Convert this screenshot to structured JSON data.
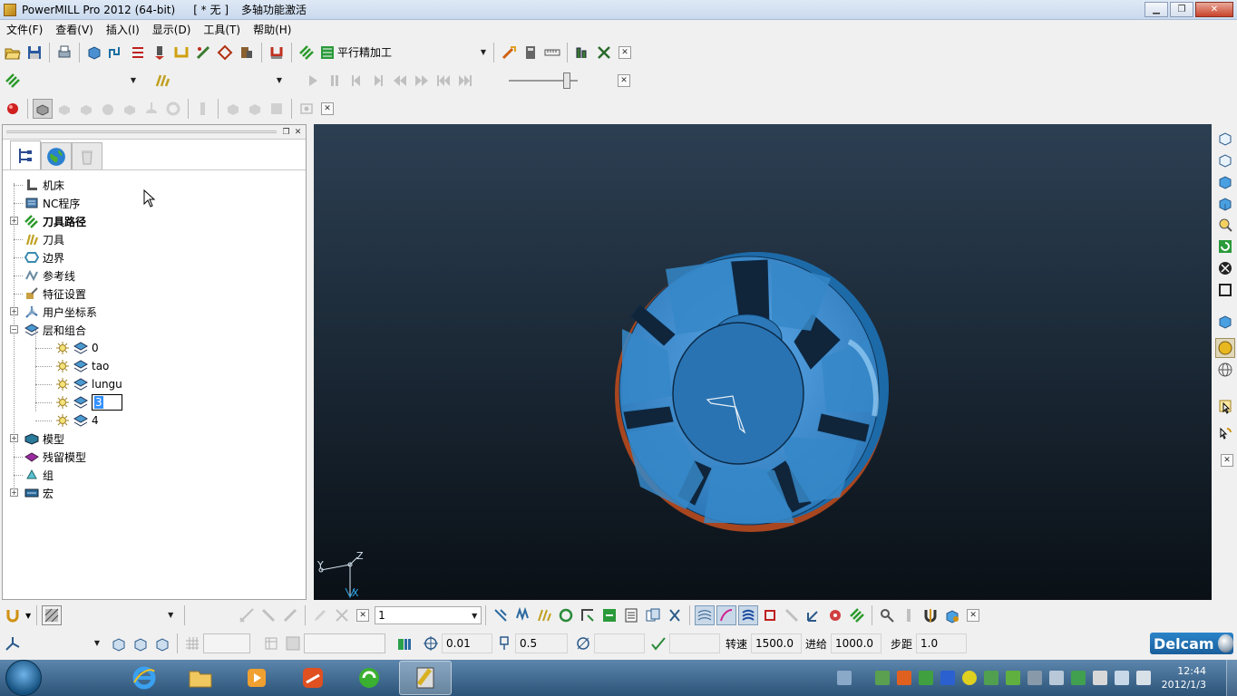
{
  "window": {
    "app_name": "PowerMILL Pro 2012 (64-bit)",
    "doc_name": "[ * 无 ]",
    "status": "多轴功能激活"
  },
  "menu": [
    "文件(F)",
    "查看(V)",
    "插入(I)",
    "显示(D)",
    "工具(T)",
    "帮助(H)"
  ],
  "toolbar1": {
    "toolpath_combo": "平行精加工"
  },
  "toolbar2": {
    "toolpath_select": "",
    "tool_select": ""
  },
  "explorer": {
    "tree": [
      {
        "label": "机床",
        "bold": false,
        "expandable": false,
        "icon": "machine-icon"
      },
      {
        "label": "NC程序",
        "bold": false,
        "expandable": false,
        "icon": "nc-program-icon"
      },
      {
        "label": "刀具路径",
        "bold": true,
        "expandable": true,
        "icon": "toolpath-icon"
      },
      {
        "label": "刀具",
        "bold": false,
        "expandable": false,
        "icon": "tool-icon"
      },
      {
        "label": "边界",
        "bold": false,
        "expandable": false,
        "icon": "boundary-icon"
      },
      {
        "label": "参考线",
        "bold": false,
        "expandable": false,
        "icon": "pattern-icon"
      },
      {
        "label": "特征设置",
        "bold": false,
        "expandable": false,
        "icon": "feature-icon"
      },
      {
        "label": "用户坐标系",
        "bold": false,
        "expandable": true,
        "icon": "workplane-icon"
      },
      {
        "label": "层和组合",
        "bold": false,
        "expandable": true,
        "expanded": true,
        "icon": "layer-icon"
      }
    ],
    "layers": [
      "0",
      "tao",
      "lungu",
      "3",
      "4"
    ],
    "editing_layer_index": 3,
    "tree_after": [
      {
        "label": "模型",
        "bold": false,
        "expandable": true,
        "icon": "model-icon"
      },
      {
        "label": "残留模型",
        "bold": false,
        "expandable": false,
        "icon": "stock-model-icon"
      },
      {
        "label": "组",
        "bold": false,
        "expandable": false,
        "icon": "group-icon"
      },
      {
        "label": "宏",
        "bold": false,
        "expandable": true,
        "icon": "macro-icon"
      }
    ]
  },
  "viewport": {
    "triad": {
      "x": "X",
      "y": "Y",
      "z": "Z"
    },
    "background_top": "#2c3f52",
    "background_bottom": "#0a1016",
    "model_color": "#2f7fc0"
  },
  "bottom_toolbar1": {
    "layer_select": "",
    "number_select": "1"
  },
  "status_bar": {
    "tolerance": "0.01",
    "thickness": "0.5",
    "spindle_label": "转速",
    "spindle_value": "1500.0",
    "feed_label": "进给",
    "feed_value": "1000.0",
    "stepover_label": "步距",
    "stepover_value": "1.0"
  },
  "brand": "Delcam",
  "taskbar": {
    "time": "12:44",
    "date": "2012/1/3"
  }
}
